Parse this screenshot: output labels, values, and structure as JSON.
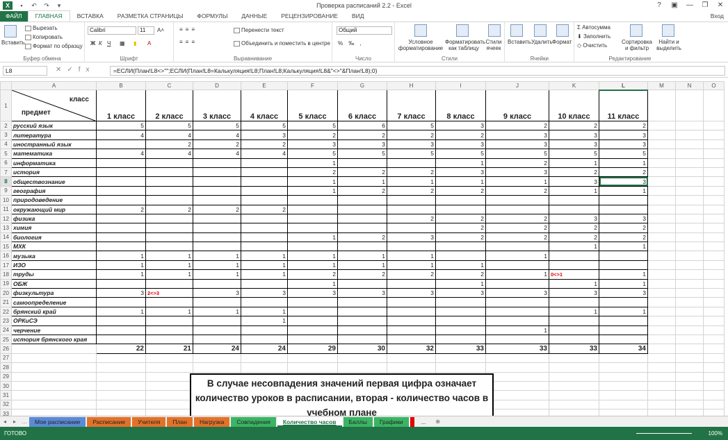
{
  "window": {
    "title": "Проверка расписаний 2.2 - Excel",
    "help": "?",
    "minimize": "—",
    "restore": "❐",
    "close": "✕",
    "signin": "Вход",
    "logo": "X"
  },
  "ribbon_tabs": [
    "ФАЙЛ",
    "ГЛАВНАЯ",
    "ВСТАВКА",
    "РАЗМЕТКА СТРАНИЦЫ",
    "ФОРМУЛЫ",
    "ДАННЫЕ",
    "РЕЦЕНЗИРОВАНИЕ",
    "ВИД"
  ],
  "ribbon": {
    "clipboard": {
      "label": "Буфер обмена",
      "paste": "Вставить",
      "cut": "Вырезать",
      "copy": "Копировать",
      "format_painter": "Формат по образцу"
    },
    "font": {
      "label": "Шрифт",
      "name": "Calibri",
      "size": "11",
      "bold": "Ж",
      "italic": "К",
      "underline": "Ч"
    },
    "alignment": {
      "label": "Выравнивание",
      "wrap": "Перенести текст",
      "merge": "Объединить и поместить в центре"
    },
    "number": {
      "label": "Число",
      "format": "Общий"
    },
    "styles": {
      "label": "Стили",
      "conditional": "Условное форматирование",
      "as_table": "Форматировать как таблицу",
      "cell_styles": "Стили ячеек"
    },
    "cells": {
      "label": "Ячейки",
      "insert": "Вставить",
      "delete": "Удалить",
      "format": "Формат"
    },
    "editing": {
      "label": "Редактирование",
      "autosum": "Автосумма",
      "fill": "Заполнить",
      "clear": "Очистить",
      "sort": "Сортировка и фильтр",
      "find": "Найти и выделить"
    }
  },
  "formula_bar": {
    "name_box": "L8",
    "formula": "=ЕСЛИ(План!L8<>\"\";ЕСЛИ(План!L8=Калькуляция!L8;План!L8;Калькуляция!L8&\"<>\"&План!L8);0)"
  },
  "columns": [
    "A",
    "B",
    "C",
    "D",
    "E",
    "F",
    "G",
    "H",
    "I",
    "J",
    "K",
    "L",
    "M",
    "N",
    "O"
  ],
  "header_row": {
    "corner_top": "класс",
    "corner_bottom": "предмет",
    "classes": [
      "1 класс",
      "2 класс",
      "3 класс",
      "4 класс",
      "5 класс",
      "6 класс",
      "7 класс",
      "8 класс",
      "9 класс",
      "10 класс",
      "11 класс"
    ]
  },
  "rows": [
    {
      "n": "2",
      "subject": "русский язык",
      "v": [
        "5",
        "5",
        "5",
        "5",
        "5",
        "6",
        "5",
        "3",
        "2",
        "2",
        "2"
      ]
    },
    {
      "n": "3",
      "subject": "литература",
      "v": [
        "4",
        "4",
        "4",
        "3",
        "2",
        "2",
        "2",
        "2",
        "3",
        "3",
        "3"
      ]
    },
    {
      "n": "4",
      "subject": "иностранный язык",
      "v": [
        "",
        "2",
        "2",
        "2",
        "3",
        "3",
        "3",
        "3",
        "3",
        "3",
        "3"
      ]
    },
    {
      "n": "5",
      "subject": "математика",
      "v": [
        "4",
        "4",
        "4",
        "4",
        "5",
        "5",
        "5",
        "5",
        "5",
        "5",
        "5"
      ]
    },
    {
      "n": "6",
      "subject": "информатика",
      "v": [
        "",
        "",
        "",
        "",
        "1",
        "",
        "",
        "1",
        "2",
        "1",
        "1"
      ]
    },
    {
      "n": "7",
      "subject": "история",
      "v": [
        "",
        "",
        "",
        "",
        "2",
        "2",
        "2",
        "3",
        "3",
        "2",
        "2"
      ]
    },
    {
      "n": "8",
      "subject": "обществознание",
      "v": [
        "",
        "",
        "",
        "",
        "1",
        "1",
        "1",
        "1",
        "1",
        "3",
        "3"
      ]
    },
    {
      "n": "9",
      "subject": "география",
      "v": [
        "",
        "",
        "",
        "",
        "1",
        "2",
        "2",
        "2",
        "2",
        "1",
        "1"
      ]
    },
    {
      "n": "10",
      "subject": "природоведение",
      "v": [
        "",
        "",
        "",
        "",
        "",
        "",
        "",
        "",
        "",
        "",
        ""
      ]
    },
    {
      "n": "11",
      "subject": "окружающий мир",
      "v": [
        "2",
        "2",
        "2",
        "2",
        "",
        "",
        "",
        "",
        "",
        "",
        ""
      ]
    },
    {
      "n": "12",
      "subject": "физика",
      "v": [
        "",
        "",
        "",
        "",
        "",
        "",
        "2",
        "2",
        "2",
        "3",
        "3"
      ]
    },
    {
      "n": "13",
      "subject": "химия",
      "v": [
        "",
        "",
        "",
        "",
        "",
        "",
        "",
        "2",
        "2",
        "2",
        "2"
      ]
    },
    {
      "n": "14",
      "subject": "биология",
      "v": [
        "",
        "",
        "",
        "",
        "1",
        "2",
        "3",
        "2",
        "2",
        "2",
        "2"
      ]
    },
    {
      "n": "15",
      "subject": "МХК",
      "v": [
        "",
        "",
        "",
        "",
        "",
        "",
        "",
        "",
        "",
        "1",
        "1"
      ]
    },
    {
      "n": "16",
      "subject": "музыка",
      "v": [
        "1",
        "1",
        "1",
        "1",
        "1",
        "1",
        "1",
        "",
        "1",
        "",
        ""
      ]
    },
    {
      "n": "17",
      "subject": "ИЗО",
      "v": [
        "1",
        "1",
        "1",
        "1",
        "1",
        "1",
        "1",
        "1",
        "",
        "",
        ""
      ]
    },
    {
      "n": "18",
      "subject": "труды",
      "v": [
        "1",
        "1",
        "1",
        "1",
        "2",
        "2",
        "2",
        "2",
        "1",
        "0<>1",
        "1"
      ]
    },
    {
      "n": "19",
      "subject": "ОБЖ",
      "v": [
        "",
        "",
        "",
        "",
        "1",
        "",
        "",
        "1",
        "",
        "1",
        "1"
      ]
    },
    {
      "n": "20",
      "subject": "физкультура",
      "v": [
        "3",
        "2<>3",
        "3",
        "3",
        "3",
        "3",
        "3",
        "3",
        "3",
        "3",
        "3"
      ]
    },
    {
      "n": "21",
      "subject": "самоопределение",
      "v": [
        "",
        "",
        "",
        "",
        "",
        "",
        "",
        "",
        "",
        "",
        ""
      ]
    },
    {
      "n": "22",
      "subject": "брянский край",
      "v": [
        "1",
        "1",
        "1",
        "1",
        "",
        "",
        "",
        "",
        "",
        "1",
        "1"
      ]
    },
    {
      "n": "23",
      "subject": "ОРКиСЭ",
      "v": [
        "",
        "",
        "",
        "1",
        "",
        "",
        "",
        "",
        "",
        "",
        ""
      ]
    },
    {
      "n": "24",
      "subject": "черчение",
      "v": [
        "",
        "",
        "",
        "",
        "",
        "",
        "",
        "",
        "1",
        "",
        ""
      ]
    },
    {
      "n": "25",
      "subject": "история брянского края",
      "v": [
        "",
        "",
        "",
        "",
        "",
        "",
        "",
        "",
        "",
        "",
        ""
      ]
    }
  ],
  "totals": {
    "n": "26",
    "v": [
      "22",
      "21",
      "24",
      "24",
      "29",
      "30",
      "32",
      "33",
      "33",
      "33",
      "34"
    ]
  },
  "empty_rows": [
    "27",
    "28",
    "29",
    "30",
    "31",
    "32",
    "33"
  ],
  "note": "В случае несовпадения значений первая цифра означает количество уроков в расписании, вторая - количество часов в учебном плане",
  "sheet_tabs": [
    {
      "label": "Мое расписание",
      "color": "#5b8bd4"
    },
    {
      "label": "Расписание",
      "color": "#e2722a"
    },
    {
      "label": "Учителя",
      "color": "#e2722a"
    },
    {
      "label": "План",
      "color": "#e2722a"
    },
    {
      "label": "Нагрузка",
      "color": "#e2722a"
    },
    {
      "label": "Совпадения",
      "color": "#3bb464"
    },
    {
      "label": "Количество часов",
      "color": "#ffffff"
    },
    {
      "label": "Баллы",
      "color": "#3bb464"
    },
    {
      "label": "Графики",
      "color": "#3bb464"
    },
    {
      "label": "",
      "color": "#e00000"
    },
    {
      "label": "...",
      "color": "#f0f0f0"
    }
  ],
  "status": {
    "ready": "ГОТОВО",
    "zoom": "100%"
  }
}
